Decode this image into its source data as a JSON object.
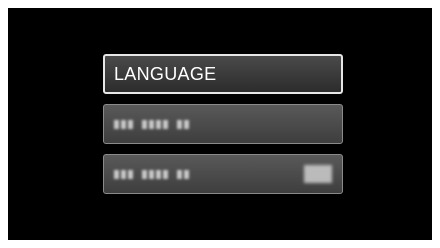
{
  "menu": {
    "items": [
      {
        "label": "LANGUAGE",
        "state": "selected"
      },
      {
        "label": "",
        "state": "normal",
        "obscured": true
      },
      {
        "label": "",
        "state": "normal",
        "obscured": true,
        "has_value": true
      }
    ]
  },
  "colors": {
    "screen_background": "#000000",
    "selected_border": "#e6e6e6",
    "item_background": "#4a4a4a",
    "text": "#ffffff"
  }
}
